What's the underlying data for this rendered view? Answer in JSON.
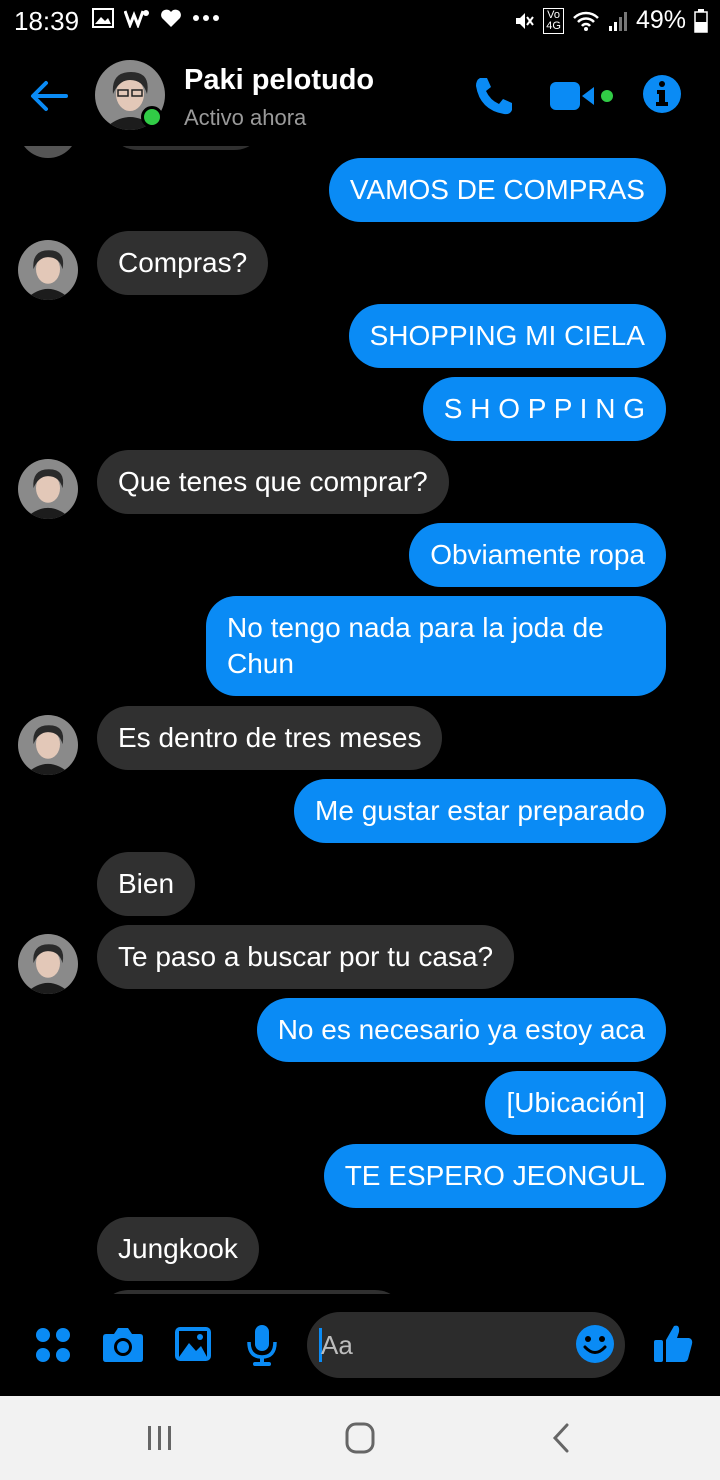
{
  "status_bar": {
    "time": "18:39",
    "battery": "49%",
    "network": "4G"
  },
  "header": {
    "name": "Paki pelotudo",
    "status": "Activo ahora"
  },
  "messages": [
    {
      "dir": "out",
      "text": "VAMOS DE COMPRAS"
    },
    {
      "dir": "in",
      "text": "Compras?"
    },
    {
      "dir": "out",
      "text": "SHOPPING MI CIELA"
    },
    {
      "dir": "out",
      "text": "S H O P P I N G"
    },
    {
      "dir": "in",
      "text": "Que tenes que comprar?"
    },
    {
      "dir": "out",
      "text": "Obviamente ropa"
    },
    {
      "dir": "out",
      "text": "No tengo nada para la joda de"
    },
    {
      "dir": "out",
      "text": "Chun"
    },
    {
      "dir": "in",
      "text": "Es dentro de tres meses"
    },
    {
      "dir": "out",
      "text": "Me gustar estar preparado"
    },
    {
      "dir": "in",
      "text": "Bien"
    },
    {
      "dir": "in",
      "text": "Te paso a buscar por tu casa?"
    },
    {
      "dir": "out",
      "text": "No es necesario ya estoy aca"
    },
    {
      "dir": "out",
      "text": "[Ubicación]"
    },
    {
      "dir": "out",
      "text": "TE ESPERO JEONGUL"
    },
    {
      "dir": "in",
      "text": "Jungkook"
    }
  ],
  "composer": {
    "placeholder": "Aa"
  },
  "colors": {
    "accent": "#0a8bf5",
    "incoming_bubble": "#303030",
    "online": "#31cc46"
  }
}
